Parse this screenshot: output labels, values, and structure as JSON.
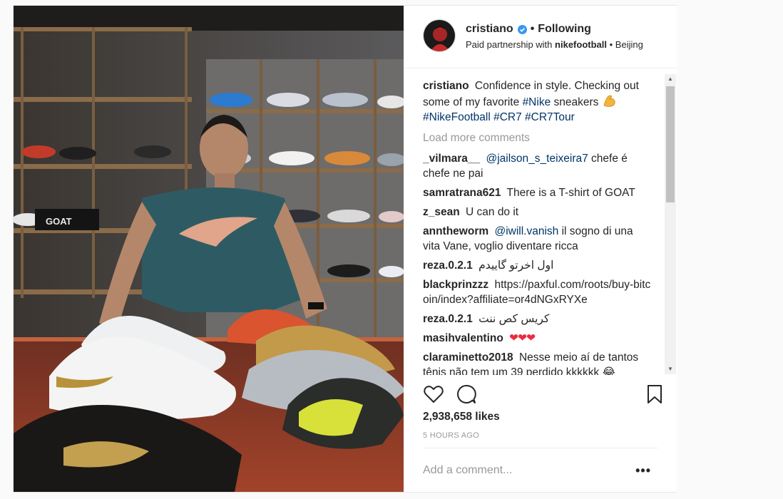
{
  "post": {
    "header": {
      "username": "cristiano",
      "separator": "•",
      "follow_status": "Following",
      "paid_partnership_prefix": "Paid partnership with",
      "partner": "nikefootball",
      "location_separator": "•",
      "location": "Beijing"
    },
    "caption": {
      "user": "cristiano",
      "text_before": "Confidence in style. Checking out some of my favorite",
      "tag_nike": "#Nike",
      "text_after": "sneakers",
      "tags_line2": "#NikeFootball #CR7 #CR7Tour"
    },
    "load_more_label": "Load more comments",
    "comments": [
      {
        "user": "_vilmara__",
        "mention": "@jailson_s_teixeira7",
        "text": "chefe é chefe ne pai"
      },
      {
        "user": "samratrana621",
        "mention": "",
        "text": "There is a T-shirt of GOAT"
      },
      {
        "user": "z_sean",
        "mention": "",
        "text": "U can do it"
      },
      {
        "user": "anntheworm",
        "mention": "@iwill.vanish",
        "text": "il sogno di una vita Vane, voglio diventare ricca"
      },
      {
        "user": "reza.0.2.1",
        "mention": "",
        "text": "اول اخرتو گاییدم"
      },
      {
        "user": "blackprinzzz",
        "mention": "",
        "text": "https://paxful.com/roots/buy-bitcoin/index?affiliate=or4dNGxRYXe"
      },
      {
        "user": "reza.0.2.1",
        "mention": "",
        "text": "کریس کص ننت"
      },
      {
        "user": "masihvalentino",
        "mention": "",
        "text": "❤❤❤"
      },
      {
        "user": "claraminetto2018",
        "mention": "",
        "text": "Nesse meio aí de tantos tênis não tem um 39 perdido kkkkkk 😂"
      }
    ],
    "likes": "2,938,658 likes",
    "time_ago": "5 HOURS AGO",
    "add_comment_placeholder": "Add a comment...",
    "more_label": "•••",
    "photo_shirt_text": "GOAT",
    "icons": {
      "verified": "verified-badge-icon",
      "like": "heart-icon",
      "comment": "comment-bubble-icon",
      "save": "bookmark-icon",
      "more": "more-options-icon"
    },
    "colors": {
      "link": "#003569",
      "muted": "#999999",
      "verified": "#3897f0",
      "heart": "#ed2a3f"
    }
  }
}
